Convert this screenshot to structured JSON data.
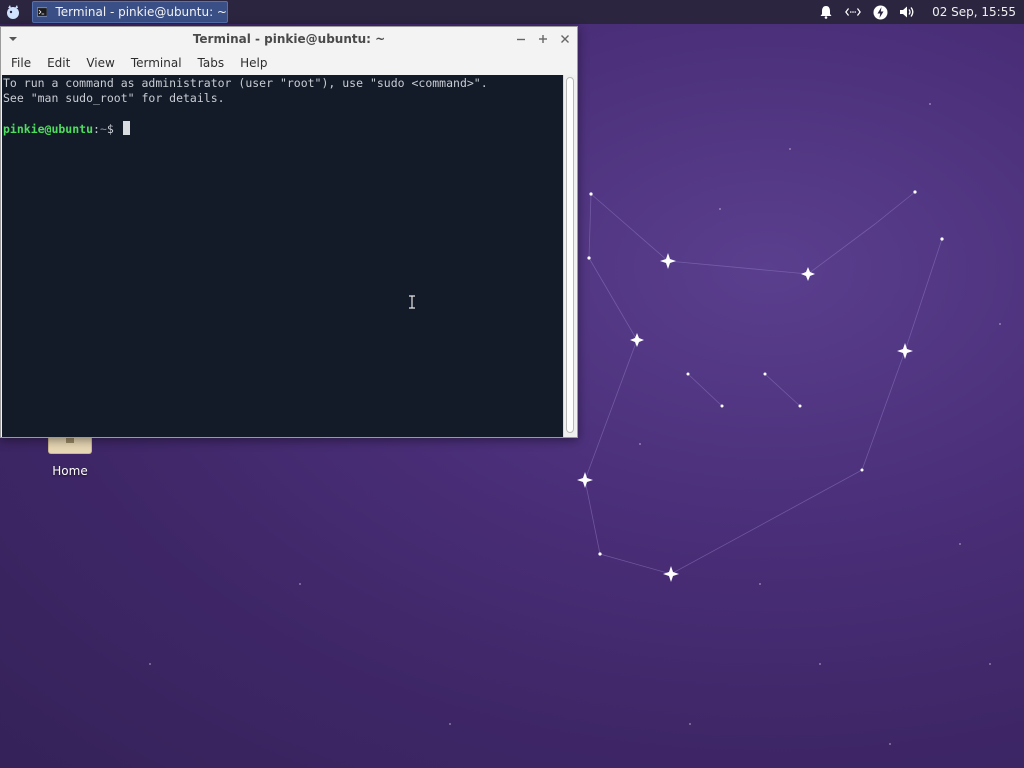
{
  "panel": {
    "app_menu_icon": "xfce-mouse-icon",
    "task_button": {
      "icon": "terminal-icon",
      "label": "Terminal - pinkie@ubuntu: ~"
    },
    "tray": {
      "icons": [
        "bell-icon",
        "network-icon",
        "power-icon",
        "volume-icon"
      ],
      "clock": "02 Sep, 15:55"
    },
    "colors": {
      "panel_bg": "#2b2540",
      "task_active_bg": "#3a4f86"
    }
  },
  "desktop": {
    "icons": [
      {
        "label": "Home",
        "icon": "home-folder-icon"
      }
    ]
  },
  "terminal": {
    "title": "Terminal - pinkie@ubuntu: ~",
    "menu": [
      "File",
      "Edit",
      "View",
      "Terminal",
      "Tabs",
      "Help"
    ],
    "output_lines": [
      "To run a command as administrator (user \"root\"), use \"sudo <command>\".",
      "See \"man sudo_root\" for details."
    ],
    "prompt": {
      "user_host": "pinkie@ubuntu",
      "separator": ":",
      "path": "~",
      "symbol": "$"
    },
    "colors": {
      "background": "#141b28",
      "prompt_user": "#4ede5e",
      "text": "#c8ccd3"
    }
  }
}
